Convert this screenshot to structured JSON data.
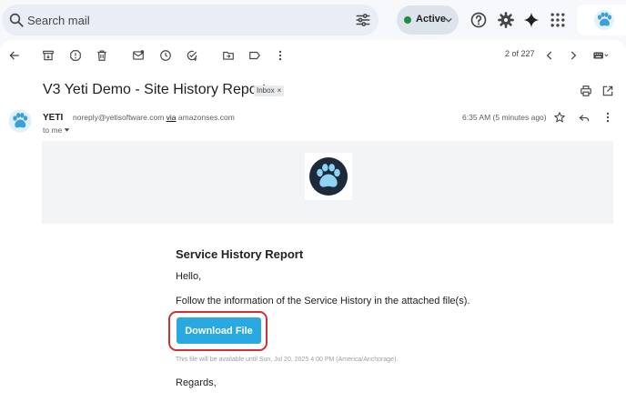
{
  "search": {
    "placeholder": "Search mail"
  },
  "status": {
    "label": "Active",
    "color": "#1e8e3e"
  },
  "top_icons": [
    "support-icon",
    "settings-icon",
    "gemini-icon",
    "apps-icon"
  ],
  "toolbar": {
    "icons": [
      "back-arrow-icon",
      "archive-icon",
      "report-spam-icon",
      "delete-icon",
      "mark-unread-icon",
      "snooze-icon",
      "add-to-tasks-icon",
      "move-to-icon",
      "label-icon",
      "more-vert-icon"
    ],
    "pager": "2 of 227"
  },
  "email": {
    "subject": "V3 Yeti Demo - Site History Report",
    "label": "Inbox",
    "label_close": "×",
    "sender_name": "YETI",
    "sender_email": "noreply@yetisoftware.com",
    "via_word": "via",
    "via_domain": "amazonses.com",
    "to": "to me",
    "time": "6:35 AM (5 minutes ago)"
  },
  "body": {
    "title": "Service History Report",
    "greeting": "Hello,",
    "message": "Follow the information of the Service History in the attached file(s).",
    "button_label": "Download File",
    "button_color": "#29a9e1",
    "highlight_color": "#d32f2f",
    "availability_note": "This file will be available until Sun, Jul 20, 2025 4:00 PM (America/Anchorage).",
    "closing": "Regards,"
  }
}
